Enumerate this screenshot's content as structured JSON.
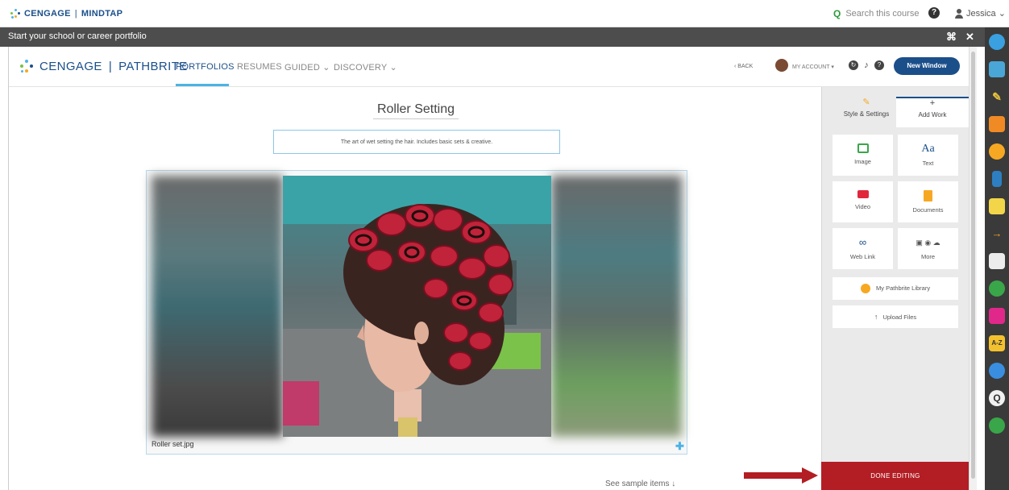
{
  "mindtap": {
    "brand": "CENGAGE",
    "product": "MINDTAP",
    "search_placeholder": "Search this course",
    "help_icon": "?",
    "user_name": "Jessica",
    "user_caret": "⌄"
  },
  "window": {
    "title": "Start your school or career portfolio",
    "expand_icon": "⌢",
    "close_icon": "✕"
  },
  "pathbrite": {
    "brand": "CENGAGE",
    "product": "PATHBRITE",
    "nav": [
      {
        "label": "PORTFOLIOS",
        "active": true
      },
      {
        "label": "RESUMES"
      },
      {
        "label": "GUIDED ⌄"
      },
      {
        "label": "DISCOVERY ⌄"
      }
    ],
    "back_label": "‹ BACK",
    "account_label": "MY ACCOUNT ▾",
    "new_window_label": "New Window"
  },
  "portfolio": {
    "title": "Roller Setting",
    "description": "The art of wet setting the hair. Includes basic sets & creative.",
    "image_caption": "Roller set.jpg",
    "add_icon": "✚",
    "see_sample": "See sample items ↓"
  },
  "panel": {
    "tabs": [
      {
        "label": "Style & Settings",
        "icon": "pencil-icon"
      },
      {
        "label": "Add Work",
        "icon": "plus-icon"
      }
    ],
    "cards": [
      {
        "label": "Image",
        "icon": "image-icon"
      },
      {
        "label": "Text",
        "icon": "text-icon",
        "glyph": "Aa"
      },
      {
        "label": "Video",
        "icon": "video-icon"
      },
      {
        "label": "Documents",
        "icon": "document-icon"
      },
      {
        "label": "Web Link",
        "icon": "link-icon"
      },
      {
        "label": "More",
        "icon": "more-icon"
      }
    ],
    "library_label": "My Pathbrite Library",
    "upload_label": "Upload Files",
    "done_label": "DONE EDITING"
  },
  "colors": {
    "brand_blue": "#1b4f8a",
    "accent_cyan": "#4db3e6",
    "done_red": "#b21e23"
  }
}
